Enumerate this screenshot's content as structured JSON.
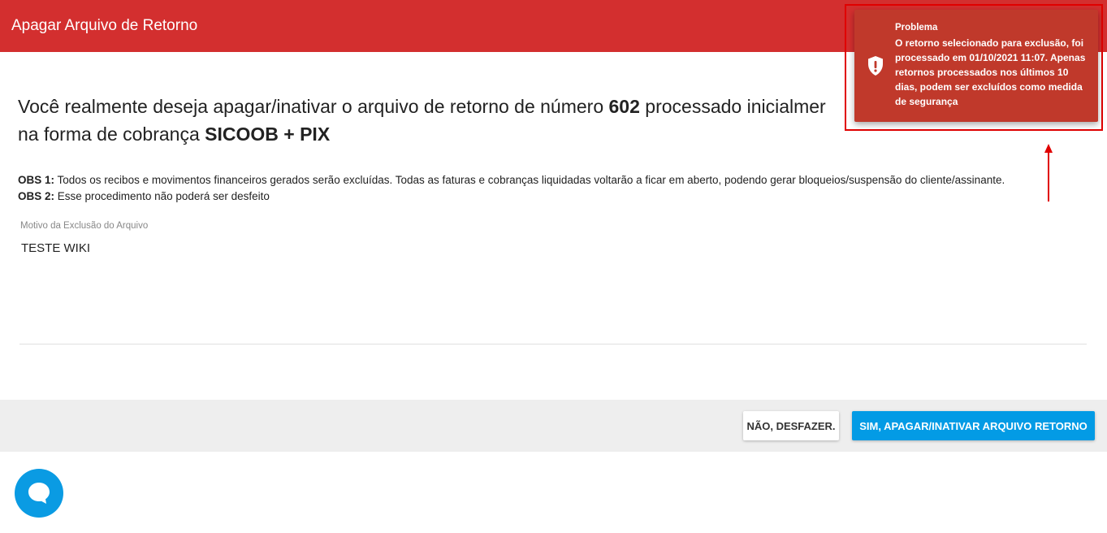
{
  "header": {
    "title": "Apagar Arquivo de Retorno"
  },
  "question": {
    "prefix": "Você realmente deseja apagar/inativar o arquivo de retorno de número ",
    "number": "602",
    "middle": " processado inicialmer",
    "line2_prefix": "na forma de cobrança ",
    "billing": "SICOOB + PIX"
  },
  "obs": [
    {
      "label": "OBS 1:",
      "text": " Todos os recibos e movimentos financeiros gerados serão excluídas. Todas as faturas e cobranças liquidadas voltarão a ficar em aberto, podendo gerar bloqueios/suspensão do cliente/assinante."
    },
    {
      "label": "OBS 2:",
      "text": " Esse procedimento não poderá ser desfeito"
    }
  ],
  "field": {
    "label": "Motivo da Exclusão do Arquivo",
    "value": "TESTE WIKI"
  },
  "buttons": {
    "cancel": "NÃO, DESFAZER.",
    "confirm": "SIM, APAGAR/INATIVAR ARQUIVO RETORNO"
  },
  "toast": {
    "title": "Problema",
    "message": "O retorno selecionado para exclusão, foi processado em 01/10/2021 11:07. Apenas retornos processados nos últimos 10 dias, podem ser excluídos como medida de segurança",
    "icon": "shield-alert-icon"
  },
  "colors": {
    "header": "#d32f2f",
    "toast": "#c0392b",
    "confirm": "#039be5",
    "chat": "#0a9be3",
    "highlight": "#e00000"
  }
}
